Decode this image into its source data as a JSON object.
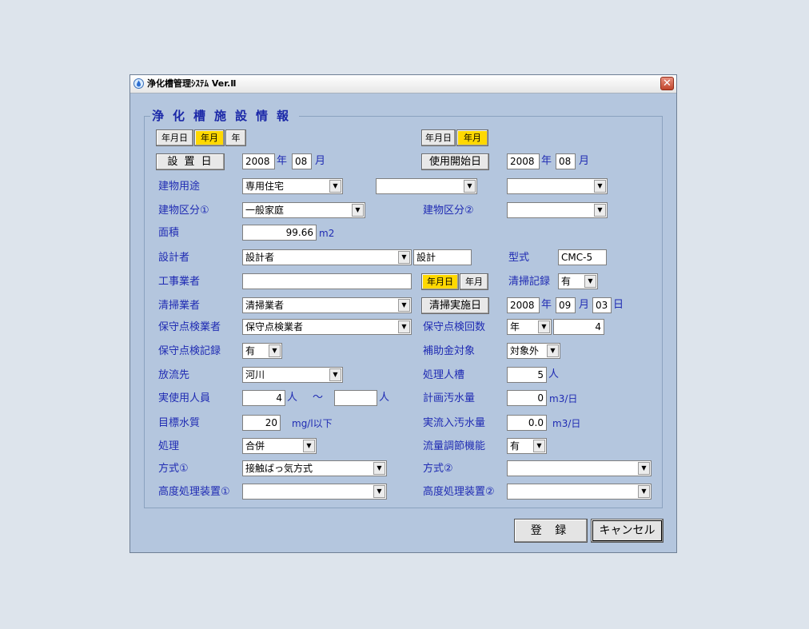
{
  "window": {
    "title": "浄化槽管理ｼｽﾃﾑ Ver.Ⅱ",
    "close": "✕",
    "icon": "water-drop-icon"
  },
  "group_title": "浄化槽施設情報",
  "toggles_left": [
    "年月日",
    "年月",
    "年"
  ],
  "toggles_right": [
    "年月日",
    "年月"
  ],
  "toggles_koji": [
    "年月日",
    "年月"
  ],
  "setchi": {
    "button": "設 置 日",
    "year": "2008",
    "year_unit": "年",
    "month": "08",
    "month_unit": "月"
  },
  "shiyo": {
    "button": "使用開始日",
    "year": "2008",
    "year_unit": "年",
    "month": "08",
    "month_unit": "月"
  },
  "labels": {
    "building_use": "建物用途",
    "building_cat1": "建物区分①",
    "building_cat2": "建物区分②",
    "area": "面積",
    "designer": "設計者",
    "model": "型式",
    "contractor": "工事業者",
    "clean_record": "清掃記録",
    "cleaner": "清掃業者",
    "maint_co": "保守点検業者",
    "maint_count": "保守点検回数",
    "maint_record": "保守点検記録",
    "subsidy": "補助金対象",
    "discharge": "放流先",
    "capacity": "処理人槽",
    "actual_users": "実使用人員",
    "plan_sewage": "計画汚水量",
    "target_quality": "目標水質",
    "actual_inflow": "実流入汚水量",
    "treatment": "処理",
    "flow_adjust": "流量調節機能",
    "method1": "方式①",
    "method2": "方式②",
    "advanced1": "高度処理装置①",
    "advanced2": "高度処理装置②"
  },
  "values": {
    "building_use_1": "専用住宅",
    "building_use_2": "",
    "building_use_3": "",
    "building_cat1": "一般家庭",
    "building_cat2": "",
    "area": "99.66",
    "area_unit": "m2",
    "designer": "設計者",
    "designer_text": "設計",
    "model": "CMC-5",
    "contractor": "",
    "clean_record": "有",
    "cleaner": "清掃業者",
    "maint_co": "保守点検業者",
    "maint_period": "年",
    "maint_count": "4",
    "maint_record": "有",
    "subsidy": "対象外",
    "discharge": "河川",
    "capacity": "5",
    "capacity_unit": "人",
    "actual_users_from": "4",
    "actual_users_unit1": "人",
    "tilde": "～",
    "actual_users_to": "",
    "actual_users_unit2": "人",
    "plan_sewage": "0",
    "plan_sewage_unit": "m3/日",
    "target_quality": "20",
    "target_quality_unit": "mg/l以下",
    "actual_inflow": "0.0",
    "actual_inflow_unit": "m3/日",
    "treatment": "合併",
    "flow_adjust": "有",
    "method1": "接触ばっ気方式",
    "method2": "",
    "advanced1": "",
    "advanced2": ""
  },
  "cleaning_date": {
    "button": "清掃実施日",
    "year": "2008",
    "year_unit": "年",
    "month": "09",
    "month_unit": "月",
    "day": "03",
    "day_unit": "日"
  },
  "footer": {
    "register": "登 録",
    "cancel": "キャンセル"
  },
  "colors": {
    "window_bg": "#b4c6de",
    "label": "#1f2bb3",
    "active_toggle": "#ffd800",
    "desktop": "#dde4ec"
  }
}
